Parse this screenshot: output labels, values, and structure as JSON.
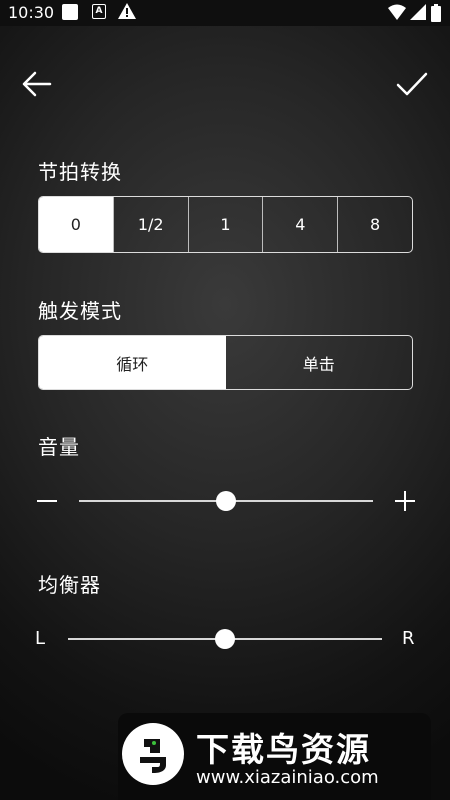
{
  "status_bar": {
    "time": "10:30",
    "notification_icons": [
      "square-icon",
      "a-badge-icon",
      "warning-icon"
    ],
    "system_icons": [
      "wifi-icon",
      "signal-icon",
      "battery-icon"
    ]
  },
  "toolbar": {
    "back_icon": "arrow-left-icon",
    "confirm_icon": "checkmark-icon"
  },
  "beat_conversion": {
    "title": "节拍转换",
    "options": [
      "0",
      "1/2",
      "1",
      "4",
      "8"
    ],
    "selected": "0"
  },
  "trigger_mode": {
    "title": "触发模式",
    "options": [
      "循环",
      "单击"
    ],
    "selected": "循环"
  },
  "volume": {
    "title": "音量",
    "value_fraction": 0.5,
    "decrease_icon": "minus-icon",
    "increase_icon": "plus-icon"
  },
  "equalizer": {
    "title": "均衡器",
    "left_label": "L",
    "right_label": "R",
    "value_fraction": 0.5
  },
  "watermark": {
    "title": "下载鸟资源",
    "url": "www.xiazainiao.com"
  },
  "colors": {
    "background": "#262626",
    "selected_segment_bg": "#ffffff",
    "selected_segment_text": "#222222",
    "foreground": "#ffffff"
  }
}
